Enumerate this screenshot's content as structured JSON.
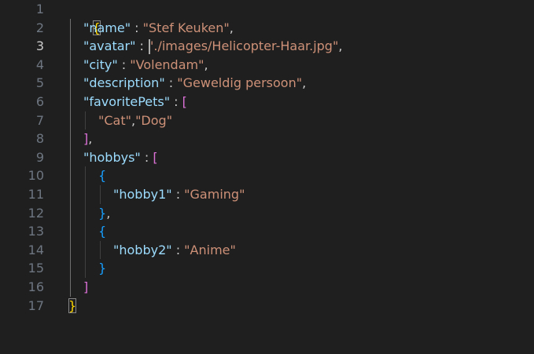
{
  "editor": {
    "line_numbers": [
      "1",
      "2",
      "3",
      "4",
      "5",
      "6",
      "7",
      "8",
      "9",
      "10",
      "11",
      "12",
      "13",
      "14",
      "15",
      "16",
      "17"
    ],
    "active_line": "3"
  },
  "code": {
    "l1": {
      "brace": "{"
    },
    "l2": {
      "key": "\"name\"",
      "sep": " : ",
      "value": "\"Stef Keuken\"",
      "tail": ","
    },
    "l3": {
      "key": "\"avatar\"",
      "sep": " : ",
      "value_a": "\"",
      "value_b": "./images/Helicopter-Haar.jpg\"",
      "tail": ","
    },
    "l4": {
      "key": "\"city\"",
      "sep": " : ",
      "value": "\"Volendam\"",
      "tail": ","
    },
    "l5": {
      "key": "\"description\"",
      "sep": " : ",
      "value": "\"Geweldig persoon\"",
      "tail": ","
    },
    "l6": {
      "key": "\"favoritePets\"",
      "sep": " : ",
      "bracket": "["
    },
    "l7": {
      "v1": "\"Cat\"",
      "comma": ",",
      "v2": "\"Dog\""
    },
    "l8": {
      "bracket": "]",
      "tail": ","
    },
    "l9": {
      "key": "\"hobbys\"",
      "sep": " : ",
      "bracket": "["
    },
    "l10": {
      "brace": "{"
    },
    "l11": {
      "key": "\"hobby1\"",
      "sep": " : ",
      "value": "\"Gaming\""
    },
    "l12": {
      "brace": "}",
      "tail": ","
    },
    "l13": {
      "brace": "{"
    },
    "l14": {
      "key": "\"hobby2\"",
      "sep": " : ",
      "value": "\"Anime\""
    },
    "l15": {
      "brace": "}"
    },
    "l16": {
      "bracket": "]"
    },
    "l17": {
      "brace": "}"
    }
  },
  "colors": {
    "background": "#1f1f1f",
    "key": "#9cdcfe",
    "string": "#ce9178",
    "bracket_level1": "#ffd700",
    "bracket_level2": "#da70d6",
    "bracket_level3": "#179fff"
  }
}
